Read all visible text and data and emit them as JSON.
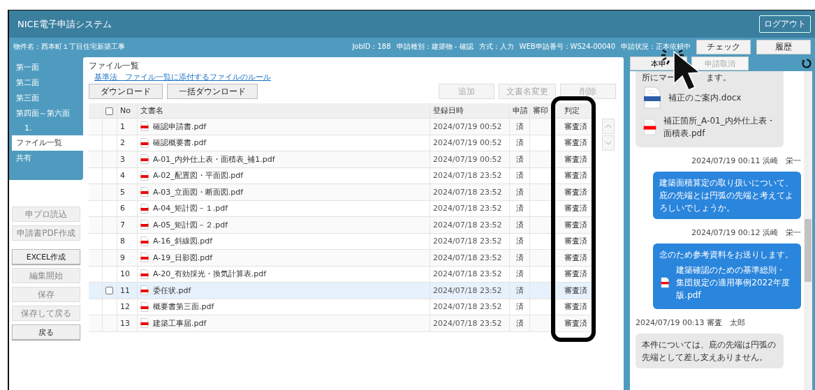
{
  "app_title": "NICE電子申請システム",
  "logout": "ログアウト",
  "info": {
    "property": "物件名：西本町１丁目住宅新築工事",
    "job_id": "JobID：188",
    "type": "申請種別：建築物 - 確認",
    "method": "方式：入力",
    "web_no": "WEB申請番号：WS24-00040",
    "status": "申請状況：正本依頼中"
  },
  "header_buttons": [
    "チェック",
    "履歴"
  ],
  "sidebar": {
    "items": [
      {
        "label": "第一面",
        "selected": false
      },
      {
        "label": "第二面",
        "selected": false
      },
      {
        "label": "第三面",
        "selected": false
      },
      {
        "label": "第四面～第六面",
        "selected": false,
        "children": [
          {
            "label": "1.",
            "selected": false
          }
        ]
      },
      {
        "label": "ファイル一覧",
        "selected": true
      },
      {
        "label": "共有",
        "selected": false
      }
    ],
    "button_groups": [
      [
        {
          "label": "申プロ読込",
          "disabled": true
        },
        {
          "label": "申請書PDF作成",
          "disabled": true
        }
      ],
      [
        {
          "label": "EXCEL作成",
          "disabled": false
        },
        {
          "label": "編集開始",
          "disabled": true
        },
        {
          "label": "保存",
          "disabled": true
        },
        {
          "label": "保存して戻る",
          "disabled": true
        },
        {
          "label": "戻る",
          "disabled": false
        }
      ]
    ]
  },
  "file_list": {
    "title": "ファイル一覧",
    "rule_link": "基準法　ファイル一覧に添付するファイルのルール",
    "left_buttons": [
      {
        "label": "ダウンロード",
        "disabled": false
      },
      {
        "label": "一括ダウンロード",
        "disabled": false
      }
    ],
    "right_buttons": [
      {
        "label": "追加",
        "disabled": true
      },
      {
        "label": "文書名変更",
        "disabled": true
      },
      {
        "label": "削除",
        "disabled": true
      }
    ],
    "select_all_checked": false,
    "columns": [
      "No",
      "文書名",
      "登録日時",
      "申請",
      "審印",
      "判定"
    ],
    "rows": [
      {
        "no": "1",
        "name": "確認申請書.pdf",
        "date": "2024/07/19 00:52",
        "applied": "済",
        "verdict": "審査済",
        "selected": false
      },
      {
        "no": "2",
        "name": "確認概要書.pdf",
        "date": "2024/07/19 00:52",
        "applied": "済",
        "verdict": "審査済",
        "selected": false
      },
      {
        "no": "3",
        "name": "A-01_内外仕上表・面積表_補1.pdf",
        "date": "2024/07/19 00:52",
        "applied": "済",
        "verdict": "審査済",
        "selected": false
      },
      {
        "no": "4",
        "name": "A-02_配置図・平面図.pdf",
        "date": "2024/07/18 23:52",
        "applied": "済",
        "verdict": "審査済",
        "selected": false
      },
      {
        "no": "5",
        "name": "A-03_立面図・断面図.pdf",
        "date": "2024/07/18 23:52",
        "applied": "済",
        "verdict": "審査済",
        "selected": false
      },
      {
        "no": "6",
        "name": "A-04_矩計図－１.pdf",
        "date": "2024/07/18 23:52",
        "applied": "済",
        "verdict": "審査済",
        "selected": false
      },
      {
        "no": "7",
        "name": "A-05_矩計図－２.pdf",
        "date": "2024/07/18 23:52",
        "applied": "済",
        "verdict": "審査済",
        "selected": false
      },
      {
        "no": "8",
        "name": "A-16_斜線図.pdf",
        "date": "2024/07/18 23:52",
        "applied": "済",
        "verdict": "審査済",
        "selected": false
      },
      {
        "no": "9",
        "name": "A-19_日影図.pdf",
        "date": "2024/07/18 23:52",
        "applied": "済",
        "verdict": "審査済",
        "selected": false
      },
      {
        "no": "10",
        "name": "A-20_有効採光・換気計算表.pdf",
        "date": "2024/07/18 23:52",
        "applied": "済",
        "verdict": "審査済",
        "selected": false
      },
      {
        "no": "11",
        "name": "委任状.pdf",
        "date": "2024/07/18 23:52",
        "applied": "済",
        "verdict": "審査済",
        "selected": true
      },
      {
        "no": "12",
        "name": "概要書第三面.pdf",
        "date": "2024/07/18 23:52",
        "applied": "済",
        "verdict": "審査済",
        "selected": false
      },
      {
        "no": "13",
        "name": "建築工事届.pdf",
        "date": "2024/07/18 23:52",
        "applied": "済",
        "verdict": "審査済",
        "selected": false
      }
    ]
  },
  "chat": {
    "buttons": [
      {
        "label": "本申",
        "disabled": false
      },
      {
        "label": "申請取消",
        "disabled": true
      }
    ],
    "messages": [
      {
        "kind": "received",
        "text": [
          "所にマー",
          "ます。"
        ],
        "attachments": [
          {
            "kind": "docx",
            "name": "補正のご案内.docx"
          },
          {
            "kind": "pdf",
            "name": "補正箇所_A-01_内外仕上表・面積表.pdf"
          }
        ]
      },
      {
        "kind": "sent",
        "meta": "2024/07/19 00:11  浜崎　栄一",
        "text": [
          "建築面積算定の取り扱いについて、庇の先端とは円弧の先端と考えてよろしいでしょうか。"
        ]
      },
      {
        "kind": "sent",
        "meta": "2024/07/19 00:12  浜崎　栄一",
        "text": [
          "念のため参考資料をお送りします。"
        ],
        "attachments": [
          {
            "kind": "pdf",
            "name": "建築確認のための基準総則・集団規定の適用事例2022年度版.pdf"
          }
        ]
      },
      {
        "kind": "received",
        "meta": "2024/07/19 00:13 審査　太郎",
        "text": [
          "本件については、庇の先端は円弧の先端として差し支えありません。"
        ]
      }
    ]
  }
}
